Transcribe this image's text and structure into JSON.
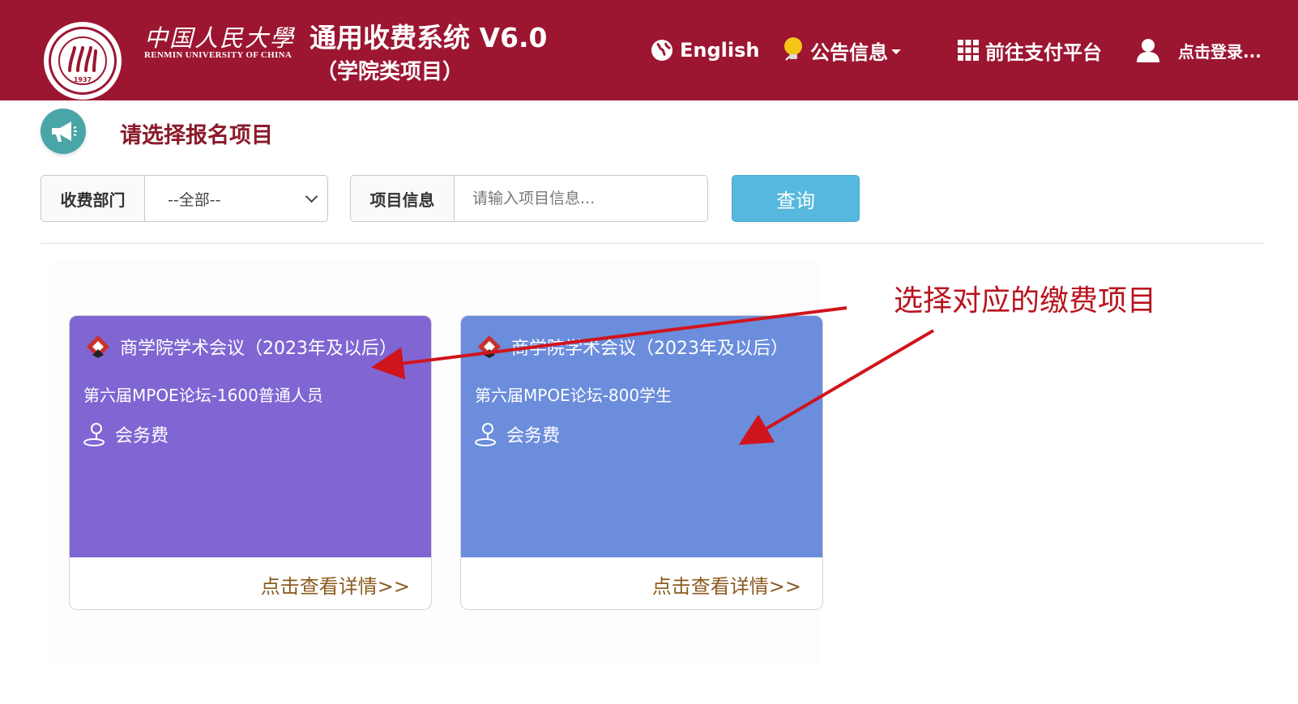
{
  "header": {
    "university_cn": "中国人民大學",
    "university_en": "RENMIN UNIVERSITY OF CHINA",
    "seal_year": "1937",
    "system_title": "通用收费系统 V6.0",
    "system_subtitle": "（学院类项目）",
    "nav": {
      "english": "English",
      "notice": "公告信息",
      "pay_platform": "前往支付平台",
      "login": "点击登录..."
    },
    "colors": {
      "brand": "#9c1631"
    }
  },
  "section": {
    "title": "请选择报名项目",
    "icon": "megaphone-icon"
  },
  "filter": {
    "dept_label": "收费部门",
    "dept_selected": "--全部--",
    "project_label": "项目信息",
    "project_placeholder": "请输入项目信息...",
    "project_value": "",
    "query_button": "查询"
  },
  "cards": [
    {
      "category": "商学院学术会议（2023年及以后）",
      "name": "第六届MPOE论坛-1600普通人员",
      "fee_type": "会务费",
      "detail_link": "点击查看详情>>",
      "color": "#8066d3"
    },
    {
      "category": "商学院学术会议（2023年及以后）",
      "name": "第六届MPOE论坛-800学生",
      "fee_type": "会务费",
      "detail_link": "点击查看详情>>",
      "color": "#6b8ddc"
    }
  ],
  "annotation": {
    "text": "选择对应的缴费项目",
    "color": "#b8141e"
  }
}
